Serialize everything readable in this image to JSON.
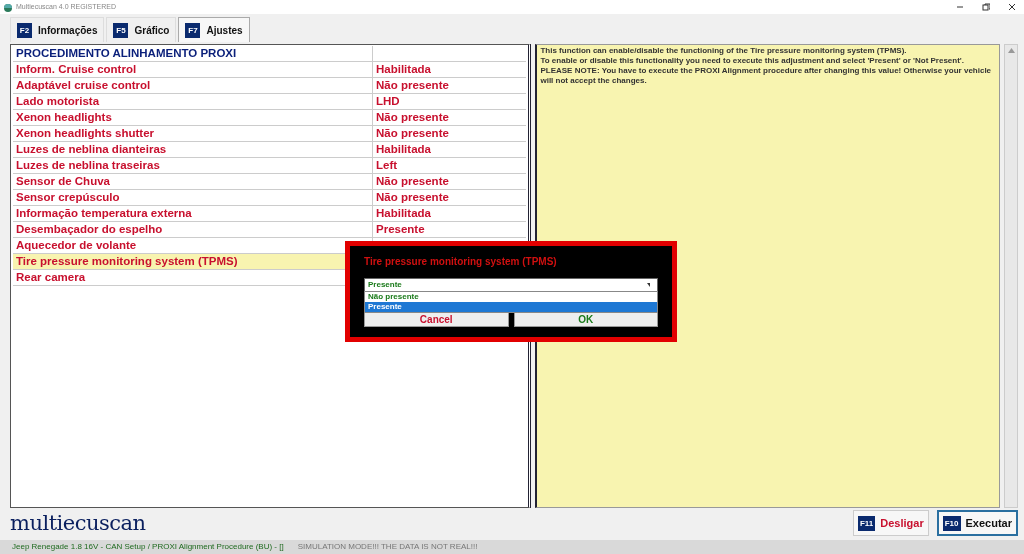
{
  "window": {
    "title": "Multiecuscan 4.0 REGISTERED"
  },
  "tabs": [
    {
      "key": "F2",
      "label": "Informações",
      "selected": false
    },
    {
      "key": "F5",
      "label": "Gráfico",
      "selected": false
    },
    {
      "key": "F7",
      "label": "Ajustes",
      "selected": true
    }
  ],
  "table": {
    "rows": [
      {
        "kind": "header",
        "name": "PROCEDIMENTO ALINHAMENTO PROXI",
        "selected": false
      },
      {
        "kind": "setting",
        "name": "Inform. Cruise control",
        "value": "Habilitada",
        "selected": false
      },
      {
        "kind": "setting",
        "name": "Adaptável cruise control",
        "value": "Não presente",
        "selected": false
      },
      {
        "kind": "setting",
        "name": "Lado motorista",
        "value": "LHD",
        "selected": false
      },
      {
        "kind": "setting",
        "name": "Xenon headlights",
        "value": "Não presente",
        "selected": false
      },
      {
        "kind": "setting",
        "name": "Xenon headlights shutter",
        "value": "Não presente",
        "selected": false
      },
      {
        "kind": "setting",
        "name": "Luzes de neblina dianteiras",
        "value": "Habilitada",
        "selected": false
      },
      {
        "kind": "setting",
        "name": "Luzes de neblina traseiras",
        "value": "Left",
        "selected": false
      },
      {
        "kind": "setting",
        "name": "Sensor de Chuva",
        "value": "Não presente",
        "selected": false
      },
      {
        "kind": "setting",
        "name": "Sensor crepúsculo",
        "value": "Não presente",
        "selected": false
      },
      {
        "kind": "setting",
        "name": "Informação temperatura externa",
        "value": "Habilitada",
        "selected": false
      },
      {
        "kind": "setting",
        "name": "Desembaçador do espelho",
        "value": "Presente",
        "selected": false
      },
      {
        "kind": "setting",
        "name": "Aquecedor de volante",
        "selected": false
      },
      {
        "kind": "setting",
        "name": "Tire pressure monitoring system (TPMS)",
        "selected": true
      },
      {
        "kind": "setting",
        "name": "Rear camera",
        "selected": false
      }
    ]
  },
  "description": [
    "This function can enable/disable the functioning of the Tire pressure monitoring system (TPMS).",
    "To enable or disable this functionality you need to execute this adjustment and select 'Present' or 'Not Present'.",
    "PLEASE NOTE: You have to execute the PROXI Alignment procedure after changing this value! Otherwise your vehicle will not accept the changes."
  ],
  "dialog": {
    "title": "Tire pressure monitoring system (TPMS)",
    "value": "Presente",
    "options": [
      {
        "label": "Não presente",
        "selected": false
      },
      {
        "label": "Presente",
        "selected": true
      }
    ],
    "buttons": [
      {
        "kind": "cancel",
        "label": "Cancel"
      },
      {
        "kind": "ok",
        "label": "OK"
      }
    ]
  },
  "logo": "multiecuscan",
  "actions": [
    {
      "key": "F11",
      "label": "Desligar",
      "kind": "danger"
    },
    {
      "key": "F10",
      "label": "Executar",
      "kind": "primary"
    }
  ],
  "status_bar": {
    "vehicle": "Jeep Renegade 1.8 16V - CAN Setup / PROXI Alignment Procedure (BU) - []",
    "notice": "SIMULATION MODE!!! THE DATA IS NOT REAL!!!"
  }
}
